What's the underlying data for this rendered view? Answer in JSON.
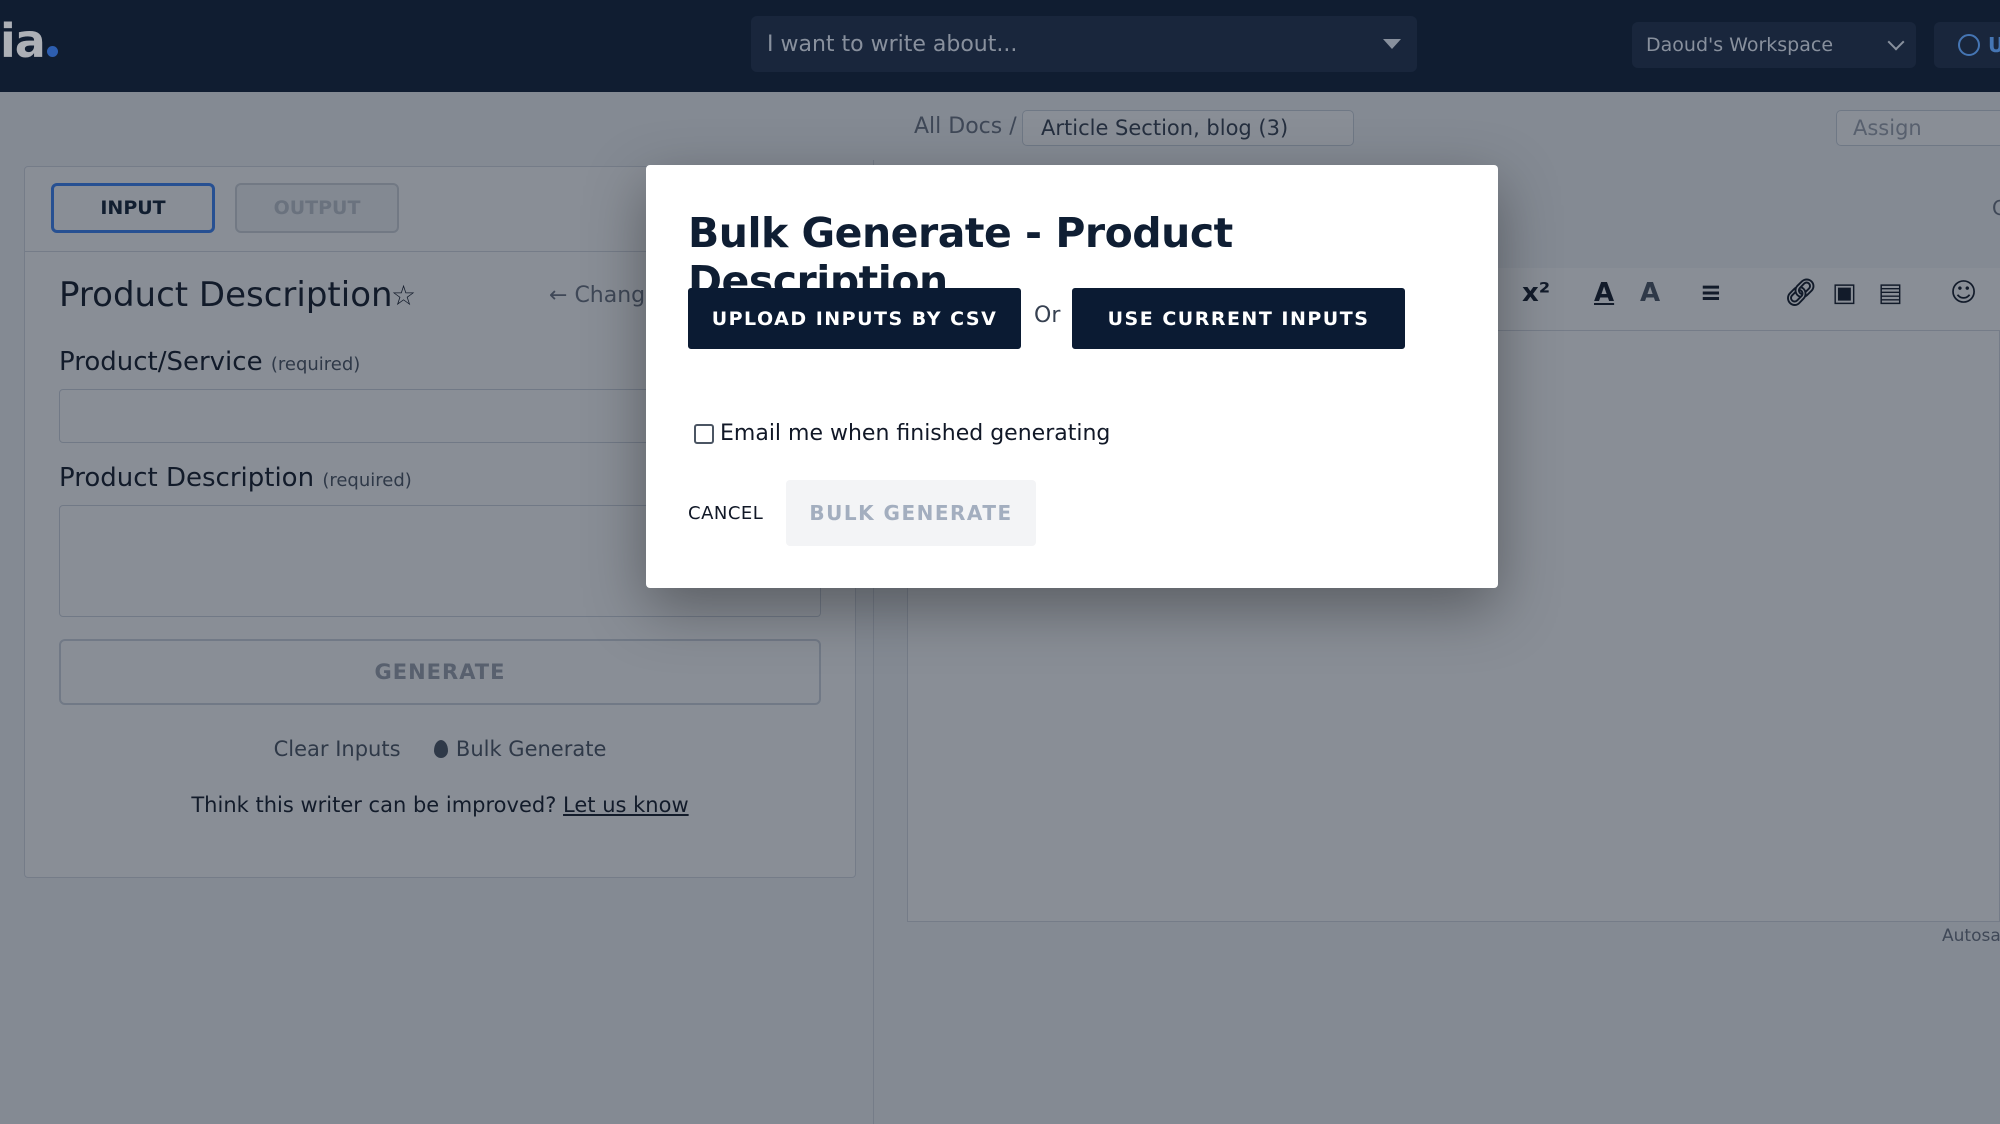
{
  "topbar": {
    "logo_text": "ia",
    "topic_placeholder": "I want to write about...",
    "workspace": "Daoud's Workspace",
    "upgrade_label": "U"
  },
  "breadcrumb": {
    "root": "All Docs /",
    "doc_name": "Article Section, blog (3)",
    "assign_placeholder": "Assign"
  },
  "left_panel": {
    "tabs": [
      {
        "label": "INPUT"
      },
      {
        "label": "OUTPUT"
      }
    ],
    "title": "Product Description",
    "change_label": "Chang",
    "fields": [
      {
        "label": "Product/Service",
        "required": "(required)",
        "value": ""
      },
      {
        "label": "Product Description",
        "required": "(required)",
        "value": ""
      }
    ],
    "generate_label": "GENERATE",
    "clear_label": "Clear Inputs",
    "bulk_label": "Bulk Generate",
    "improve_text": "Think this writer can be improved?",
    "improve_link": "Let us know"
  },
  "editor": {
    "superscript_label": "x²",
    "autosave_label": "Autosa",
    "right_edge_label": "C"
  },
  "modal": {
    "title": "Bulk Generate - Product Description",
    "upload_csv_label": "UPLOAD INPUTS BY CSV",
    "or_label": "Or",
    "use_current_label": "USE CURRENT INPUTS",
    "email_label": "Email me when finished generating",
    "email_checked": false,
    "cancel_label": "CANCEL",
    "bulk_generate_label": "BULK GENERATE"
  },
  "colors": {
    "navy": "#0b1b33",
    "accent_blue": "#3b82f6",
    "topbar": "#0f1e33"
  }
}
